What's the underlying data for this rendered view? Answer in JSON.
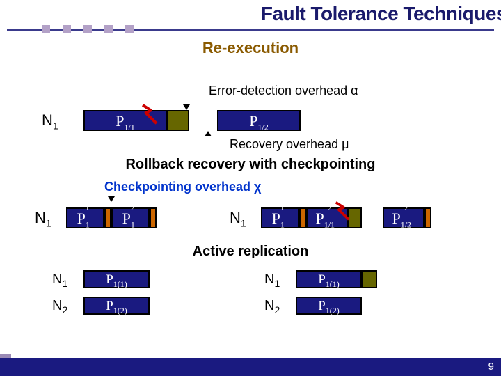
{
  "slide": {
    "title": "Fault Tolerance Techniques",
    "page_number": "9"
  },
  "sections": {
    "reexec": {
      "title": "Re-execution",
      "error_label": "Error-detection overhead α",
      "recovery_label": "Recovery overhead μ",
      "node": "N",
      "node_idx": "1",
      "p11": "P",
      "p11_sub": "1/1",
      "p12": "P",
      "p12_sub": "1/2"
    },
    "rollback": {
      "title_a": "Rollback recovery with",
      "title_b": "checkpointing",
      "chk_label": "Checkpointing overhead χ",
      "left": {
        "node": "N",
        "node_idx": "1",
        "p1": "P",
        "p1_sub": "1",
        "p1_sup": "1",
        "p2": "P",
        "p2_sub": "1",
        "p2_sup": "2"
      },
      "right": {
        "node": "N",
        "node_idx": "1",
        "p1": "P",
        "p1_sub": "1",
        "p1_sup": "1",
        "p21": "P",
        "p21_sub": "1/1",
        "p21_sup": "2",
        "p22": "P",
        "p22_sub": "1/2",
        "p22_sup": "2"
      }
    },
    "activerep": {
      "title": "Active replication",
      "left": {
        "n1": "N",
        "n1_idx": "1",
        "p11": "P",
        "p11_sub": "1(1)",
        "n2": "N",
        "n2_idx": "2",
        "p12": "P",
        "p12_sub": "1(2)"
      },
      "right": {
        "n1": "N",
        "n1_idx": "1",
        "p11": "P",
        "p11_sub": "1(1)",
        "n2": "N",
        "n2_idx": "2",
        "p12": "P",
        "p12_sub": "1(2)"
      }
    }
  }
}
